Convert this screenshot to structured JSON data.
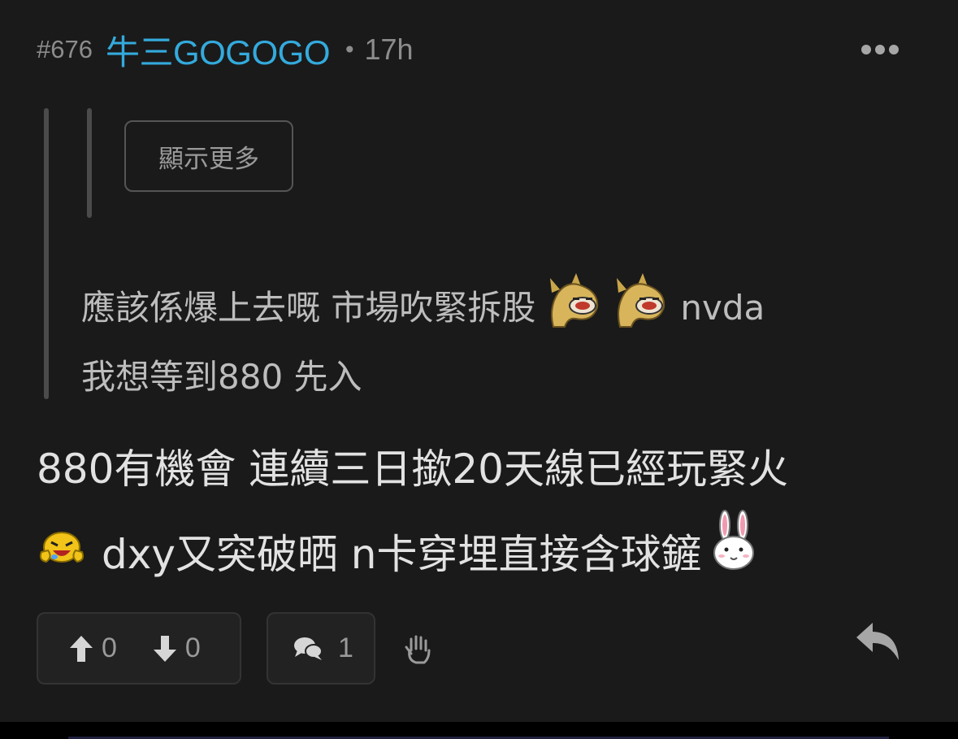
{
  "post": {
    "floor": "#676",
    "username": "牛三GOGOGO",
    "separator": "•",
    "time": "17h"
  },
  "quote": {
    "show_more": "顯示更多",
    "line1_text": "應該係爆上去嘅 市場吹緊拆股",
    "line1_suffix": "nvda",
    "line2": "我想等到880 先入"
  },
  "body": {
    "line1": "880有機會 連續三日撳20天線已經玩緊火",
    "line2_text": "dxy又突破晒 n卡穿埋直接含球鏟"
  },
  "actions": {
    "upvotes": "0",
    "downvotes": "0",
    "comments": "1"
  },
  "icons": {
    "more": "more-dots-icon",
    "upvote": "arrow-up-icon",
    "downvote": "arrow-down-icon",
    "comment": "comment-bubble-icon",
    "block": "wave-hand-icon",
    "reply": "reply-arrow-icon"
  },
  "colors": {
    "background": "#1a1a1a",
    "username": "#34aadc",
    "meta": "#8c8c8c",
    "quote_text": "#bdbdbd",
    "body_text": "#e2e2e2"
  }
}
